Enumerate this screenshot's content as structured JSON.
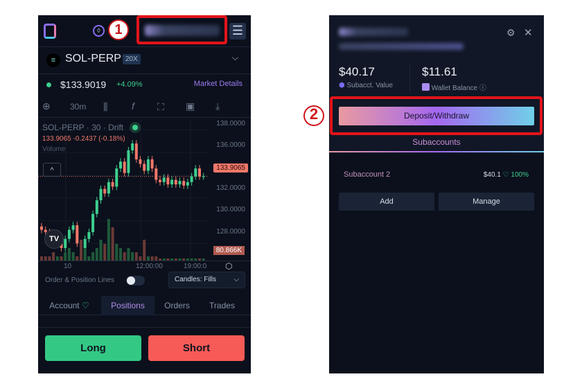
{
  "left": {
    "annotation": "1",
    "menu_icon": "hamburger-icon",
    "market": {
      "symbol": "SOL-PERP",
      "leverage": "20X"
    },
    "price": "$133.9019",
    "change": "+4.09%",
    "market_details": "Market Details",
    "toolbar": {
      "interval": "30m"
    },
    "chart_legend": {
      "title": "SOL-PERP · 30 · Drift",
      "ohlc": "133.9065",
      "delta": "-0.2437",
      "delta_pct": "(-0.18%)",
      "volume": "Volume"
    },
    "price_axis": [
      "138.0000",
      "136.0000",
      "132.0000",
      "130.0000",
      "128.0000"
    ],
    "current_price_label": "133.9065",
    "volume_label": "80.866K",
    "time_axis": [
      "10",
      "12:00:00",
      "19:00:0"
    ],
    "order_lines_label": "Order & Position Lines",
    "candles_select": "Candles: Fills",
    "tabs": [
      "Account",
      "Positions",
      "Orders",
      "Trades"
    ],
    "long": "Long",
    "short": "Short",
    "colors": {
      "up": "#3ecf8e",
      "down": "#f0786a",
      "long": "#33c985",
      "short": "#f75b57",
      "accent": "#9d7cf0"
    }
  },
  "right": {
    "annotation": "2",
    "subacct_value": "$40.17",
    "subacct_label": "Subacct. Value",
    "wallet_value": "$11.61",
    "wallet_label": "Wallet Balance",
    "deposit_withdraw": "Deposit/Withdraw",
    "subaccounts_tab": "Subaccounts",
    "subaccount": {
      "name": "Subaccount 2",
      "value": "$40.1",
      "health": "100%"
    },
    "add": "Add",
    "manage": "Manage"
  },
  "chart_data": {
    "type": "candlestick",
    "closes": [
      129.2,
      129,
      128.8,
      128.2,
      128.6,
      127.6,
      128.4,
      129.2,
      129.6,
      128,
      127.6,
      128.4,
      129,
      130.6,
      131.8,
      132.8,
      132.4,
      133.4,
      133,
      134.6,
      135.2,
      134.2,
      136.2,
      136.8,
      135.4,
      135,
      134.4,
      135.4,
      134.6,
      133.6,
      133.4,
      133.8,
      133.2,
      133.6,
      133.2,
      133.5,
      133.1,
      133.4,
      133.9,
      134.6,
      133.9,
      133.9
    ],
    "volumes": [
      1,
      1,
      1,
      2,
      1,
      1,
      2,
      3,
      2,
      1,
      5,
      3,
      1,
      2,
      3,
      5,
      4,
      10,
      8,
      4,
      3,
      2,
      3,
      2,
      2,
      1,
      5,
      1,
      1,
      1,
      0.5,
      0.5,
      0.5,
      0.5,
      0.5,
      0.5,
      0.5,
      0.5,
      0.5,
      0.5,
      0.5,
      0.5
    ],
    "ylim": [
      126.5,
      139
    ]
  }
}
